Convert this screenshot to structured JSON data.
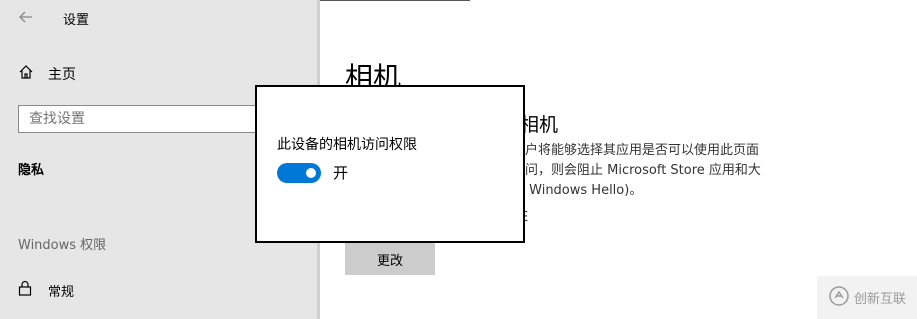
{
  "window": {
    "app_title": "设置"
  },
  "sidebar": {
    "home_label": "主页",
    "search_placeholder": "查找设置",
    "privacy_heading": "隐私",
    "section_heading": "Windows 权限",
    "general_label": "常规"
  },
  "main": {
    "page_title": "相机",
    "sub_title": "相机",
    "description_lines": [
      "用户将能够选择其应用是否可以使用此页面",
      "访问，则会阻止 Microsoft Store 应用和大",
      "止 Windows Hello)。"
    ],
    "obscured_text": "E",
    "change_button_label": "更改"
  },
  "modal": {
    "label": "此设备的相机访问权限",
    "toggle_state": "开",
    "toggle_on": true
  },
  "watermark": {
    "text": "创新互联"
  },
  "colors": {
    "accent": "#0078d7",
    "sidebar_bg": "#e6e6e6",
    "button_bg": "#cccccc"
  },
  "icons": {
    "back": "back-arrow-icon",
    "home": "home-icon",
    "general": "lock-icon",
    "watermark": "watermark-logo-icon"
  }
}
